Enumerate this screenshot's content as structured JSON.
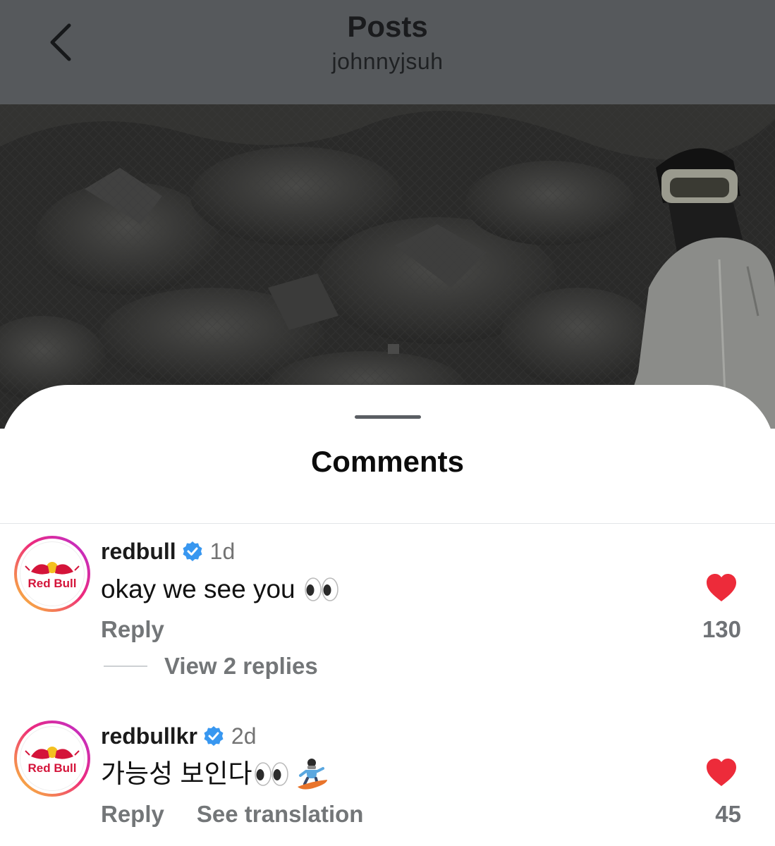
{
  "header": {
    "title": "Posts",
    "subtitle": "johnnyjsuh"
  },
  "sheet": {
    "title": "Comments"
  },
  "comments": [
    {
      "username": "redbull",
      "verified": true,
      "time": "1d",
      "text": "okay we see you",
      "emojis": [
        "eyes"
      ],
      "reply_label": "Reply",
      "likes": "130",
      "view_replies": "View 2 replies",
      "avatar_logo_text": "Red Bull"
    },
    {
      "username": "redbullkr",
      "verified": true,
      "time": "2d",
      "text": "가능성 보인다",
      "emojis": [
        "eyes",
        "snowboarder"
      ],
      "reply_label": "Reply",
      "translation_label": "See translation",
      "likes": "45",
      "avatar_logo_text": "Red Bull"
    }
  ],
  "colors": {
    "heart": "#ed2b3a",
    "verified": "#3897f0",
    "overlay": "#56595c"
  }
}
